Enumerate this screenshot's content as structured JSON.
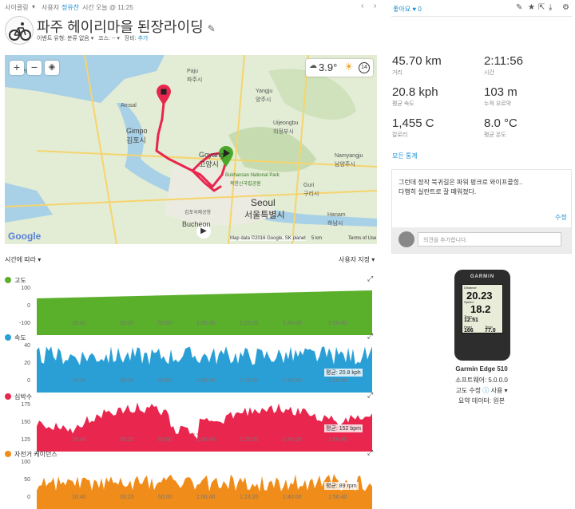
{
  "topbar": {
    "category": "사이클링",
    "user_label": "사용자",
    "user_name": "정유찬",
    "time": "시간 오늘 @ 11:25"
  },
  "activity": {
    "title": "파주 헤이리마을 된장라이딩",
    "event_type": "이벤트 유형: 분류 없음",
    "course": "코스: --",
    "gear_label": "장비:",
    "gear_add": "추가"
  },
  "map": {
    "zoom_in": "+",
    "zoom_out": "−",
    "temp": "3.9°",
    "day": "14",
    "attribution": "Map data ©2016 Google, SK planet",
    "scale": "5 km",
    "terms": "Terms of Use",
    "google": "Google",
    "places": [
      "Paju",
      "파주시",
      "Yangju",
      "양주시",
      "Gimpo",
      "김포시",
      "Uijeongbu",
      "의정부시",
      "Goyang",
      "고양시",
      "Bukhansan National Park",
      "북한산국립공원",
      "Namyangju",
      "남양주시",
      "Guri",
      "구리시",
      "Seoul",
      "서울특별시",
      "Hanam",
      "하남시",
      "김포국제공항",
      "Bucheon",
      "Ansa",
      "Arnsal"
    ]
  },
  "chart_controls": {
    "axis_mode": "시간에 따라",
    "custom": "사용자 지정"
  },
  "charts": [
    {
      "name": "고도",
      "color": "#5aaf2b",
      "y": [
        "100",
        "0",
        "-100"
      ],
      "avg": ""
    },
    {
      "name": "속도",
      "color": "#2a9fd6",
      "y": [
        "40",
        "20",
        "0"
      ],
      "avg": "평균: 20.8 kph"
    },
    {
      "name": "심박수",
      "color": "#e8264e",
      "y": [
        "175",
        "150",
        "125"
      ],
      "avg": "평균: 152 bpm"
    },
    {
      "name": "자전거 케이던스",
      "color": "#f08c1a",
      "y": [
        "100",
        "50",
        "0"
      ],
      "avg": "평균: 89 rpm"
    }
  ],
  "xticks": [
    "16:40",
    "33:20",
    "50:00",
    "1:06:40",
    "1:23:20",
    "1:40:00",
    "1:56:40"
  ],
  "stats": [
    {
      "value": "45.70 km",
      "label": "거리"
    },
    {
      "value": "2:11:56",
      "label": "시간"
    },
    {
      "value": "20.8 kph",
      "label": "평균 속도"
    },
    {
      "value": "103 m",
      "label": "누적 오르막"
    },
    {
      "value": "1,455 C",
      "label": "칼로리"
    },
    {
      "value": "8.0 °C",
      "label": "평균 온도"
    }
  ],
  "like": {
    "label": "좋아요",
    "count": "0"
  },
  "all_stats": "모든 통계",
  "comment": {
    "text1": "그런데 정작 북귀길은 파워 펑크로 와이프콜힝..",
    "text2": "다행히 실란트로 잘 때워졌다.",
    "edit": "수정",
    "placeholder": "의견을 추가합니다."
  },
  "device": {
    "brand": "GARMIN",
    "name": "Garmin Edge 510",
    "software": "소프트웨어: 5.0.0.0",
    "altitude_label": "고도 수정",
    "altitude_value": "사용",
    "summary": "요약 데이터: 원본",
    "screen": {
      "distance_label": "Distance",
      "distance": "20.23",
      "speed_label": "Speed",
      "speed": "18.2",
      "time_label": "Timer",
      "time": "12:51",
      "hr_label": "Heart",
      "hr": "166",
      "temp_label": "Temp",
      "temp": "77.0"
    }
  }
}
